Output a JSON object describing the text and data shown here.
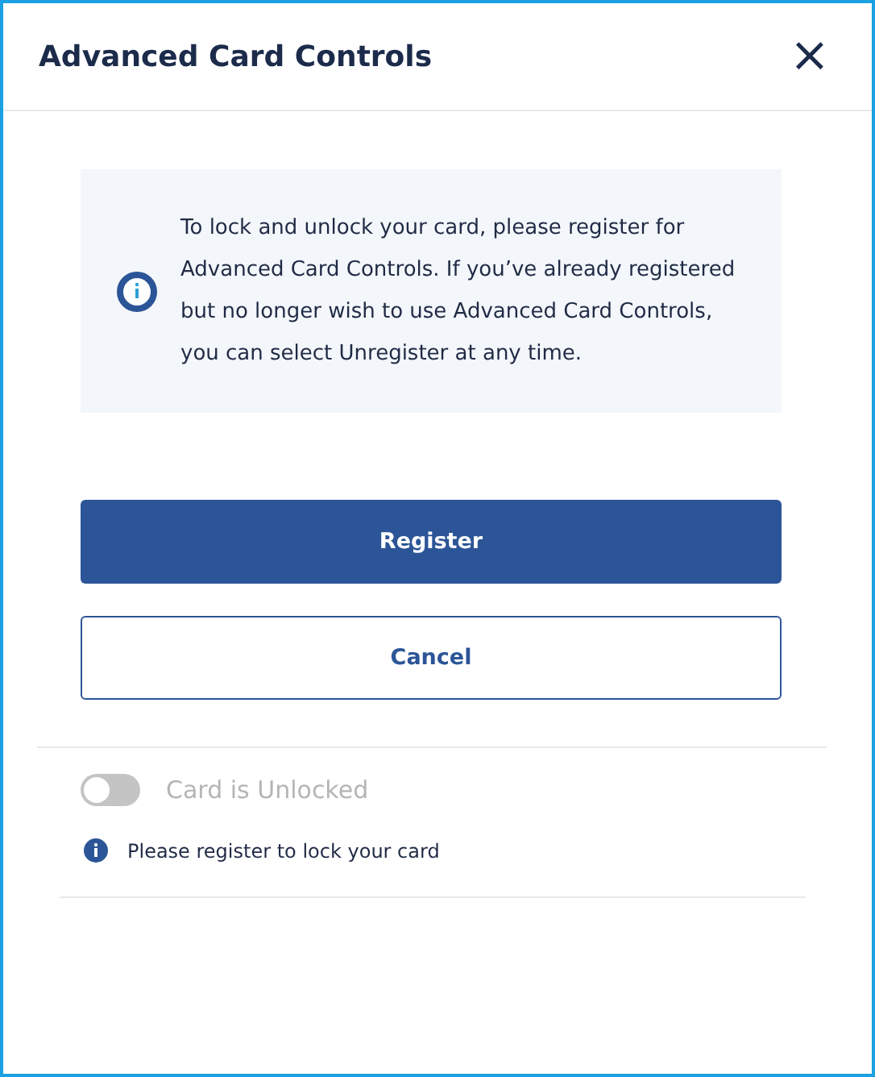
{
  "dialog": {
    "title": "Advanced Card Controls",
    "close": "×"
  },
  "notice": {
    "text": "To lock and unlock your card, please register for Advanced Card Controls. If you’ve already registered but no longer wish to use Advanced Card Controls, you can select Unregister at any time."
  },
  "buttons": [
    {
      "label": "Register",
      "kind": "primary"
    },
    {
      "label": "Cancel",
      "kind": "secondary"
    }
  ],
  "toggle": {
    "label": "Card is Unlocked",
    "on": false,
    "disabled": true
  },
  "hint": "Please register to lock your card"
}
